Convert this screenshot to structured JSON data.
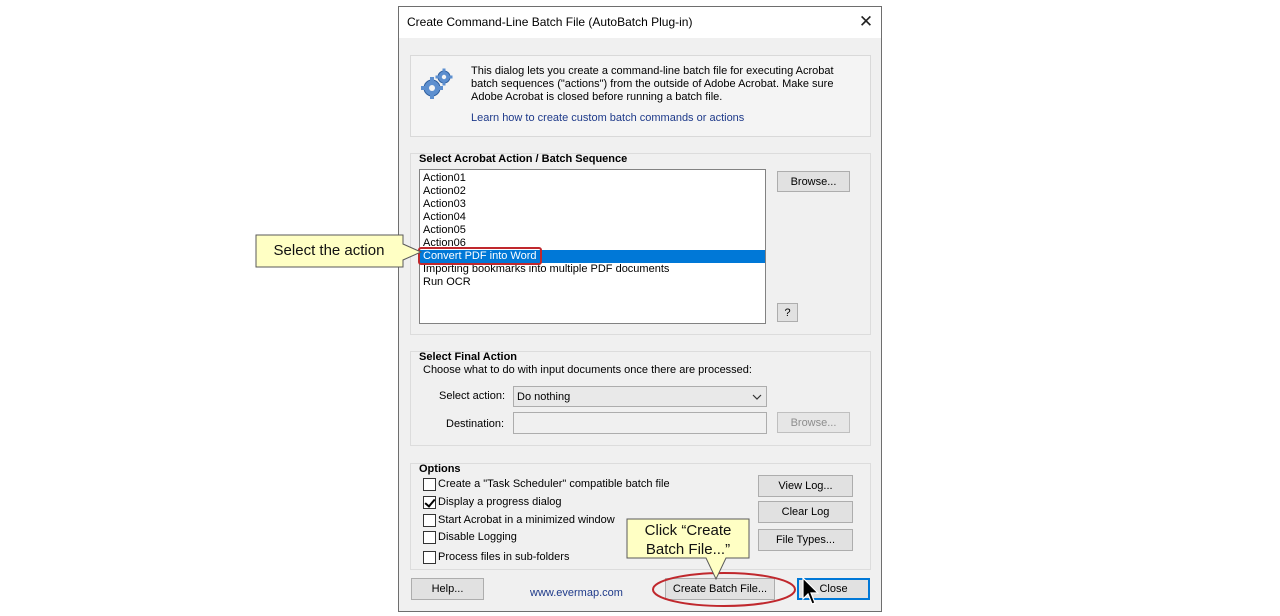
{
  "window": {
    "title": "Create Command-Line Batch File (AutoBatch Plug-in)",
    "close_glyph": "✕"
  },
  "intro": {
    "text": "This dialog lets you create a command-line batch file for executing Acrobat batch sequences (\"actions\") from the outside of Adobe Acrobat. Make sure Adobe Acrobat is closed before running a batch file.",
    "link": "Learn how to create custom batch commands or actions",
    "icon": "gears-icon"
  },
  "action_group": {
    "label": "Select Acrobat Action / Batch Sequence",
    "items": [
      "Action01",
      "Action02",
      "Action03",
      "Action04",
      "Action05",
      "Action06",
      "Convert PDF into Word",
      "Importing bookmarks into multiple PDF documents",
      "Run OCR"
    ],
    "selected": "Convert PDF into Word",
    "browse_label": "Browse...",
    "help_label": "?"
  },
  "final_action": {
    "label": "Select Final Action",
    "description": "Choose what to do with input documents once there are processed:",
    "select_label": "Select action:",
    "select_value": "Do nothing",
    "destination_label": "Destination:",
    "destination_value": "",
    "browse_label": "Browse..."
  },
  "options": {
    "label": "Options",
    "items": [
      {
        "label": "Create a \"Task Scheduler\" compatible batch file",
        "checked": false
      },
      {
        "label": "Display a progress dialog",
        "checked": true
      },
      {
        "label": "Start Acrobat in a minimized window",
        "checked": false
      },
      {
        "label": "Disable Logging",
        "checked": false
      },
      {
        "label": "Process files in sub-folders",
        "checked": false
      }
    ],
    "view_log": "View Log...",
    "clear_log": "Clear Log",
    "file_types": "File Types..."
  },
  "footer": {
    "help": "Help...",
    "website": "www.evermap.com",
    "create": "Create Batch File...",
    "close": "Close"
  },
  "callouts": {
    "select_action": "Select the action",
    "click_create_line1": "Click “Create",
    "click_create_line2": "Batch File...”"
  },
  "colors": {
    "selection": "#0078d7",
    "callout_fill": "#ffffc4",
    "highlight_ring": "#c0282d",
    "link": "#1e3a8a"
  }
}
